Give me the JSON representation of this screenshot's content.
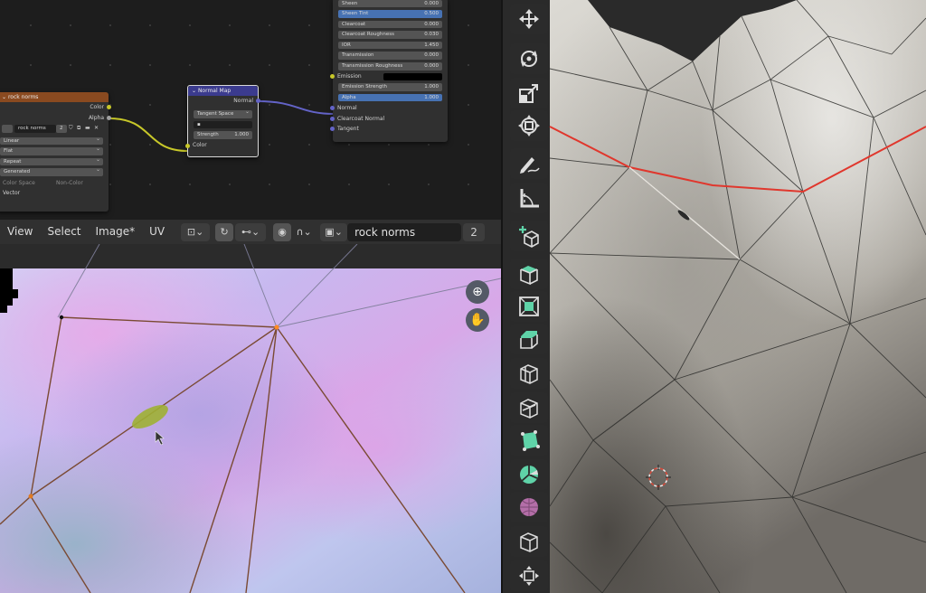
{
  "node_editor": {
    "principled_rows": [
      "Sheen",
      "Sheen Tint",
      "Clearcoat",
      "Clearcoat Roughness",
      "IOR",
      "Transmission",
      "Transmission Roughness"
    ],
    "principled_values": [
      "0.000",
      "0.500",
      "0.000",
      "0.030",
      "1.450",
      "0.000",
      "0.000"
    ],
    "emission_label": "Emission",
    "emission_strength_label": "Emission Strength",
    "emission_strength_value": "1.000",
    "alpha_label": "Alpha",
    "alpha_value": "1.000",
    "normal_label": "Normal",
    "clearcoat_normal_label": "Clearcoat Normal",
    "tangent_label": "Tangent",
    "image_node": {
      "title": "rock norms",
      "out_color": "Color",
      "out_alpha": "Alpha",
      "image_name": "rock norms",
      "user_count": "2",
      "interpolation": "Linear",
      "projection": "Flat",
      "extension": "Repeat",
      "source": "Generated",
      "color_space_label": "Color Space",
      "color_space_value": "Non-Color",
      "vector_label": "Vector"
    },
    "normal_map_node": {
      "title": "Normal Map",
      "out_normal": "Normal",
      "space": "Tangent Space",
      "strength_label": "Strength",
      "strength_value": "1.000",
      "in_color": "Color"
    },
    "colors": {
      "image_header": "#8a4a20",
      "normal_map_header": "#3b3b8e",
      "color_link": "#c7c729",
      "vector_link": "#6363c7"
    }
  },
  "image_editor": {
    "menus": [
      "View",
      "Select",
      "Image*",
      "UV"
    ],
    "image_name": "rock norms",
    "user_count": "2"
  },
  "toolbar": {
    "tools": [
      "move-icon",
      "rotate-icon",
      "scale-icon",
      "transform-icon",
      "annotate-icon",
      "measure-icon",
      "add-cube-icon",
      "extrude-region-icon",
      "inset-faces-icon",
      "bevel-icon",
      "loop-cut-icon",
      "knife-icon",
      "poly-build-icon",
      "spin-icon",
      "smooth-icon",
      "edge-slide-icon",
      "shrink-fatten-icon"
    ],
    "accent": "#5fd3a8"
  }
}
